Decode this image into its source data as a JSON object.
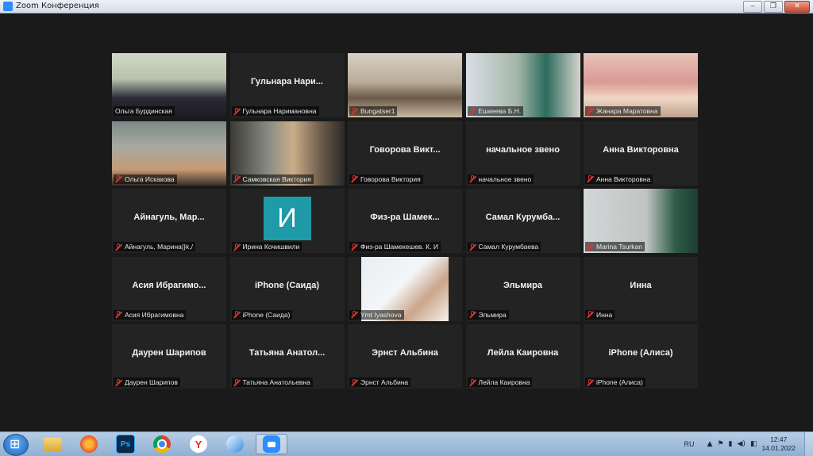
{
  "window": {
    "title": "Zoom Конференция",
    "controls": [
      "‒",
      "❐",
      "✕"
    ]
  },
  "tiles": [
    {
      "label": "Ольга Бурдинская",
      "display": "",
      "video": "speaker",
      "active": true,
      "muted": false
    },
    {
      "label": "Гульнара Наримановна",
      "display": "Гульнара Нари...",
      "muted": true
    },
    {
      "label": "Bungatser1",
      "display": "",
      "video": "classroom",
      "muted": true
    },
    {
      "label": "Ешкеева Б.Н.",
      "display": "",
      "video": "classroom2",
      "muted": true
    },
    {
      "label": "Жанара Маратовна",
      "display": "",
      "video": "room-pink",
      "muted": true
    },
    {
      "label": "Ольга Искакова",
      "display": "",
      "video": "women-room",
      "muted": true
    },
    {
      "label": "Самковская Виктория",
      "display": "",
      "video": "shelf-room",
      "muted": true
    },
    {
      "label": "Говорова Виктория",
      "display": "Говорова Викт...",
      "muted": true
    },
    {
      "label": "начальное звено",
      "display": "начальное звено",
      "muted": true
    },
    {
      "label": "Анна Викторовна",
      "display": "Анна Викторовна",
      "muted": true
    },
    {
      "label": "Айнагуль, Марина|}k,/",
      "display": "Айнагуль, Мар...",
      "muted": true
    },
    {
      "label": "Ирина Кочишвили",
      "display": "",
      "avatar": "И",
      "muted": true
    },
    {
      "label": "Физ-ра Шамекешев. К. И",
      "display": "Физ-ра Шамек...",
      "muted": true
    },
    {
      "label": "Самал Курумбаева",
      "display": "Самал Курумба...",
      "muted": true
    },
    {
      "label": "Marina Tsurkan",
      "display": "",
      "video": "masked",
      "muted": true
    },
    {
      "label": "Асия Ибрагимовна",
      "display": "Асия Ибрагимо...",
      "muted": true
    },
    {
      "label": "iPhone (Саида)",
      "display": "iPhone (Саида)",
      "muted": true
    },
    {
      "label": "Ymt Iyashova",
      "display": "",
      "video": "glasses",
      "muted": true
    },
    {
      "label": "Эльмира",
      "display": "Эльмира",
      "muted": true
    },
    {
      "label": "Инна",
      "display": "Инна",
      "muted": true
    },
    {
      "label": "Даурен Шарипов",
      "display": "Даурен Шарипов",
      "muted": true
    },
    {
      "label": "Татьяна Анатольевна",
      "display": "Татьяна Анатол...",
      "muted": true
    },
    {
      "label": "Эрнст Альбина",
      "display": "Эрнст Альбина",
      "muted": true
    },
    {
      "label": "Лейла Каировна",
      "display": "Лейла Каировна",
      "muted": true
    },
    {
      "label": "iPhone (Алиса)",
      "display": "iPhone (Алиса)",
      "muted": true
    }
  ],
  "taskbar": {
    "apps": [
      "folder-icon",
      "firefox-icon",
      "photoshop-icon",
      "chrome-icon",
      "yandex-icon",
      "feather-app-icon",
      "zoom-icon"
    ],
    "ps_text": "Ps",
    "yandex_text": "Y",
    "lang": "RU",
    "time": "12:47",
    "date": "14.01.2022"
  },
  "colors": {
    "active_border": "#c7d84a",
    "muted_mic": "#e0332b",
    "avatar_bg": "#1e9aa8"
  }
}
